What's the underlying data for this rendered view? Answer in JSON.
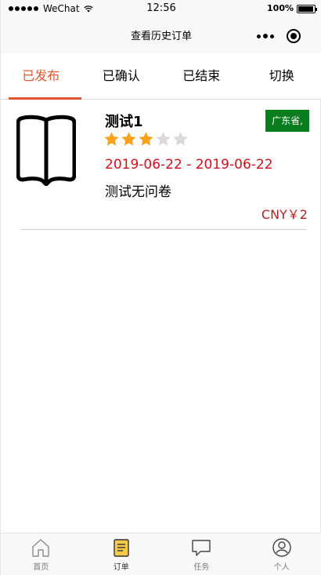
{
  "status_bar": {
    "carrier": "WeChat",
    "time": "12:56",
    "battery": "100%"
  },
  "nav": {
    "title": "查看历史订单"
  },
  "tabs": [
    {
      "label": "已发布",
      "active": true
    },
    {
      "label": "已确认",
      "active": false
    },
    {
      "label": "已结束",
      "active": false
    },
    {
      "label": "切换",
      "active": false
    }
  ],
  "order": {
    "name": "测试1",
    "region": "广东省,",
    "rating": 3,
    "rating_max": 5,
    "dates": "2019-06-22 - 2019-06-22",
    "description": "测试无问卷",
    "price": "CNY￥2"
  },
  "tabbar": [
    {
      "label": "首页",
      "icon": "home-icon"
    },
    {
      "label": "订单",
      "icon": "order-icon"
    },
    {
      "label": "任务",
      "icon": "task-icon"
    },
    {
      "label": "个人",
      "icon": "person-icon"
    }
  ],
  "colors": {
    "accent": "#e4572e",
    "region_badge": "#0a7d1e",
    "date_text": "#d0101a",
    "star_on": "#f9a11b",
    "star_off": "#d9d9d9"
  }
}
